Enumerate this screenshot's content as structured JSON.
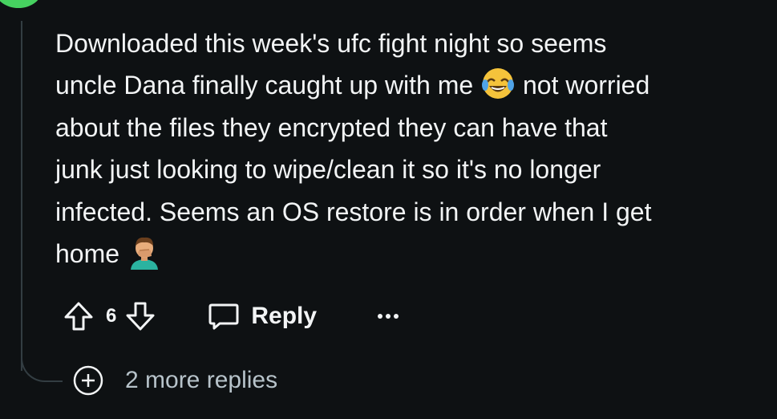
{
  "comment": {
    "line1": "Downloaded this week's ufc fight night so seems",
    "line2a": "uncle Dana finally caught up with me ",
    "line2b": " not worried",
    "line3": "about the files they encrypted they can have that",
    "line4": "junk just looking to wipe/clean it so it's no longer",
    "line5": "infected. Seems an OS restore is in order when I get",
    "line6": "home ",
    "emoji1": "face-with-tears-of-joy",
    "emoji2": "man-facepalming"
  },
  "actions": {
    "vote_count": "6",
    "reply_label": "Reply"
  },
  "more_replies": {
    "label": "2 more replies"
  },
  "colors": {
    "background": "#0e1113",
    "text": "#f2f4f5",
    "muted": "#b7c3ca",
    "thread_line": "#333d42",
    "avatar": "#46d160"
  }
}
